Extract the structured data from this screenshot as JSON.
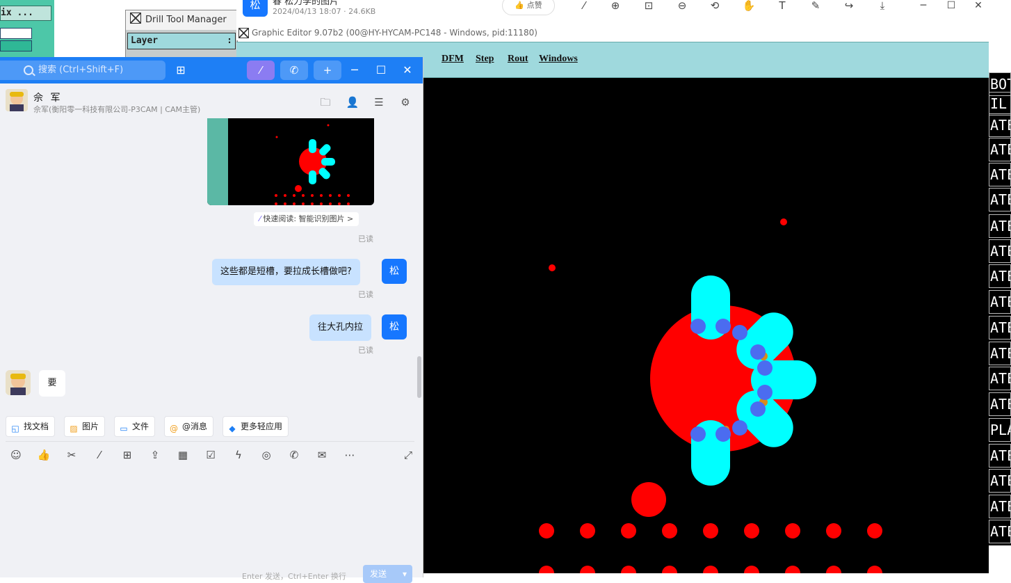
{
  "matrix_window": {
    "title": "ix ..."
  },
  "drill_manager": {
    "title": "Drill Tool Manager",
    "layer_label": "Layer",
    "layer_colon": ":"
  },
  "viewer": {
    "avatar": "松",
    "title": "春 松力李的图片",
    "meta": "2024/04/13 18:07 · 24.6KB",
    "like_label": "点赞"
  },
  "graphic_editor": {
    "title": "Graphic Editor 9.07b2 (00@HY-HYCAM-PC148 - Windows, pid:11180)",
    "menu": [
      "DFM",
      "Step",
      "Rout",
      "Windows"
    ]
  },
  "layer_list": [
    "BOT",
    "IL",
    "ATE",
    "ATE",
    "ATE",
    "ATE",
    "ATE",
    "ATE",
    "ATE",
    "ATE",
    "ATE",
    "ATE",
    "ATE",
    "ATE",
    "PLA",
    "ATE",
    "ATE",
    "ATE",
    "ATE"
  ],
  "chat": {
    "search_placeholder": "搜索 (Ctrl+Shift+F)",
    "contact_name": "佘 军",
    "contact_sub": "佘军(衡阳零一科技有限公司-P3CAM | CAM主管)",
    "ai_read": "快速阅读: 智能识别图片 >",
    "read_label": "已读",
    "my_avatar": "松",
    "messages": [
      {
        "text": "这些都是短槽，要拉成长槽做吧?"
      },
      {
        "text": "往大孔内拉"
      },
      {
        "text": "要"
      }
    ],
    "quick_actions": [
      "找文档",
      "图片",
      "文件",
      "@消息",
      "更多轻应用"
    ],
    "send_hint": "Enter 发送，Ctrl+Enter 换行",
    "send_label": "发送"
  },
  "colors": {
    "accent": "#1e7ff5",
    "pad_red": "#ff0000",
    "slot_cyan": "#00ffff",
    "drill_blue": "#4b6cf0"
  }
}
